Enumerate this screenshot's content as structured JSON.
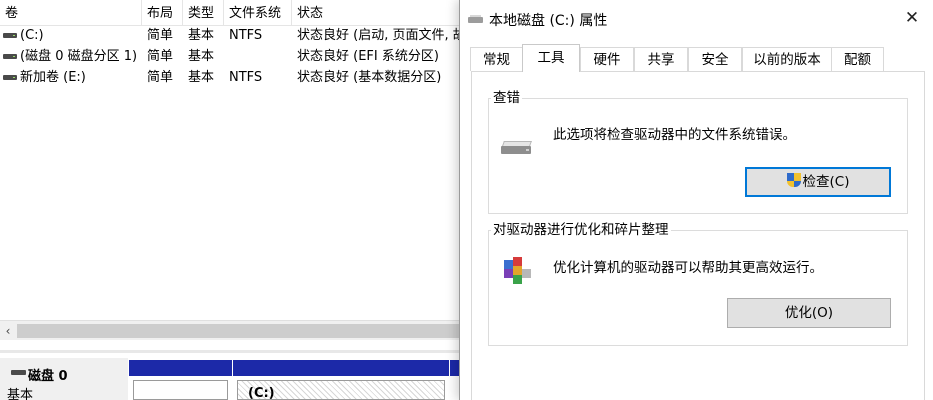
{
  "volume_list": {
    "columns": [
      "卷",
      "布局",
      "类型",
      "文件系统",
      "状态"
    ],
    "rows": [
      {
        "volume": "(C:)",
        "layout": "简单",
        "type": "基本",
        "fs": "NTFS",
        "status": "状态良好 (启动, 页面文件, 故"
      },
      {
        "volume": "(磁盘 0 磁盘分区 1)",
        "layout": "简单",
        "type": "基本",
        "fs": "",
        "status": "状态良好 (EFI 系统分区)"
      },
      {
        "volume": "新加卷 (E:)",
        "layout": "简单",
        "type": "基本",
        "fs": "NTFS",
        "status": "状态良好 (基本数据分区)"
      }
    ],
    "scroll_left_arrow": "‹"
  },
  "disk_view": {
    "disk_name": "磁盘 0",
    "disk_type": "基本",
    "partition_label": "(C:)"
  },
  "dialog": {
    "title": "本地磁盘 (C:) 属性",
    "close_glyph": "✕",
    "tabs": [
      "常规",
      "工具",
      "硬件",
      "共享",
      "安全",
      "以前的版本",
      "配额"
    ],
    "active_tab": "工具",
    "error_check": {
      "title": "查错",
      "description": "此选项将检查驱动器中的文件系统错误。",
      "button": "检查(C)"
    },
    "optimize": {
      "title": "对驱动器进行优化和碎片整理",
      "description": "优化计算机的驱动器可以帮助其更高效运行。",
      "button": "优化(O)"
    }
  },
  "colors": {
    "partition_bar": "#1c29a8",
    "focus_border": "#0078d7",
    "button_face": "#e1e1e1"
  }
}
